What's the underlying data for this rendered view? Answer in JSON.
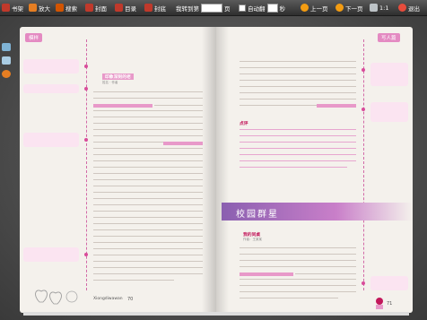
{
  "toolbar": {
    "bookshelf": "书架",
    "zoom_in": "放大",
    "search": "搜索",
    "cover": "封面",
    "toc": "目录",
    "back_cover": "封底",
    "jump_to": "我转到第",
    "page_unit": "页",
    "autoflip": "自动翻",
    "seconds": "秒",
    "prev": "上一页",
    "next": "下一页",
    "ratio": "1:1",
    "exit": "退出"
  },
  "book": {
    "left_header_tag": "模样",
    "right_header_tag": "写人篇",
    "left_section_title": "印象深刻的老",
    "left_section_sub": "姓名 · 作者",
    "left_highlight_1": "一一",
    "left_notes": [
      "",
      "",
      "",
      ""
    ],
    "banner": "校园群星",
    "right_section_title": "我的同桌",
    "right_section_sub": "作者：王某某",
    "right_mid_title": "点评",
    "footer_text": "Xiongdiwawan",
    "page_left": "70",
    "page_right": "71"
  },
  "colors": {
    "accent": "#d94c9a",
    "banner": "#8a5fb0",
    "highlight": "#e899c9"
  }
}
